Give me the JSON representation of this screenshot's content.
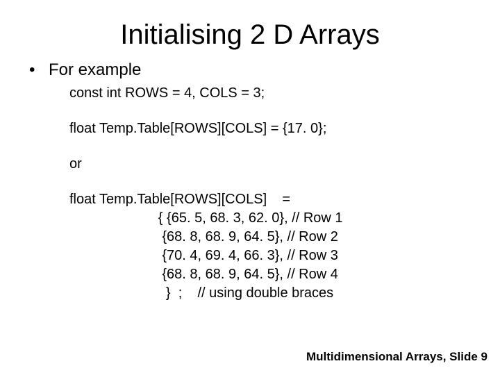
{
  "title": "Initialising 2 D Arrays",
  "bullet": "For example",
  "code": {
    "l1": "const int ROWS = 4, COLS = 3;",
    "l2": "float Temp.Table[ROWS][COLS] = {17. 0};",
    "l3": "or",
    "l4": "float Temp.Table[ROWS][COLS]    =",
    "l5": "                       { {65. 5, 68. 3, 62. 0}, // Row 1",
    "l6": "                        {68. 8, 68. 9, 64. 5}, // Row 2",
    "l7": "                        {70. 4, 69. 4, 66. 3}, // Row 3",
    "l8": "                        {68. 8, 68. 9, 64. 5}, // Row 4",
    "l9": "                         }  ;    // using double braces"
  },
  "footer": "Multidimensional Arrays, Slide 9"
}
